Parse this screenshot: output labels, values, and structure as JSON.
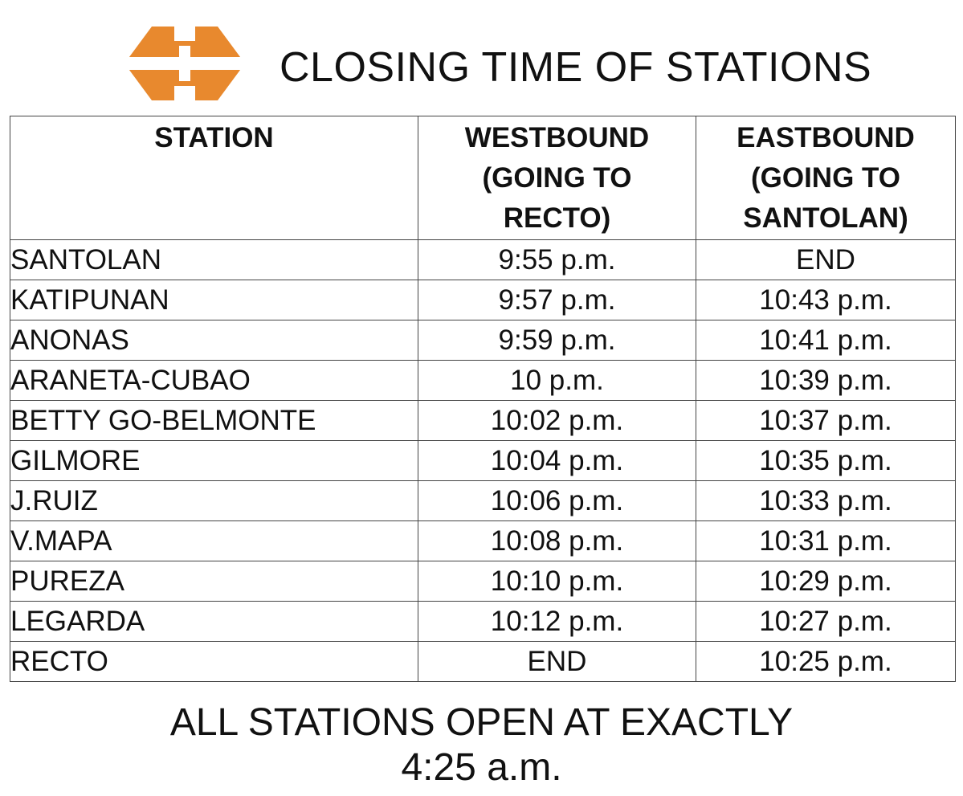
{
  "header": {
    "title": "CLOSING TIME OF STATIONS",
    "logo_icon": "lrt2-logo-icon",
    "logo_color": "#E8892E"
  },
  "table": {
    "columns": [
      {
        "lines": [
          "STATION"
        ]
      },
      {
        "lines": [
          "WESTBOUND",
          "(GOING TO",
          "RECTO)"
        ]
      },
      {
        "lines": [
          "EASTBOUND",
          "(GOING TO",
          "SANTOLAN)"
        ]
      }
    ],
    "rows": [
      {
        "station": "SANTOLAN",
        "westbound": "9:55 p.m.",
        "eastbound": "END"
      },
      {
        "station": "KATIPUNAN",
        "westbound": "9:57 p.m.",
        "eastbound": "10:43 p.m."
      },
      {
        "station": "ANONAS",
        "westbound": "9:59 p.m.",
        "eastbound": "10:41 p.m."
      },
      {
        "station": "ARANETA-CUBAO",
        "westbound": "10 p.m.",
        "eastbound": "10:39 p.m."
      },
      {
        "station": "BETTY GO-BELMONTE",
        "westbound": "10:02 p.m.",
        "eastbound": "10:37 p.m."
      },
      {
        "station": "GILMORE",
        "westbound": "10:04 p.m.",
        "eastbound": "10:35 p.m."
      },
      {
        "station": "J.RUIZ",
        "westbound": "10:06 p.m.",
        "eastbound": "10:33 p.m."
      },
      {
        "station": "V.MAPA",
        "westbound": "10:08 p.m.",
        "eastbound": "10:31 p.m."
      },
      {
        "station": "PUREZA",
        "westbound": "10:10 p.m.",
        "eastbound": "10:29 p.m."
      },
      {
        "station": "LEGARDA",
        "westbound": "10:12 p.m.",
        "eastbound": "10:27 p.m."
      },
      {
        "station": "RECTO",
        "westbound": "END",
        "eastbound": "10:25 p.m."
      }
    ]
  },
  "footer": {
    "line1": "ALL STATIONS OPEN AT EXACTLY",
    "line2": "4:25 a.m."
  }
}
